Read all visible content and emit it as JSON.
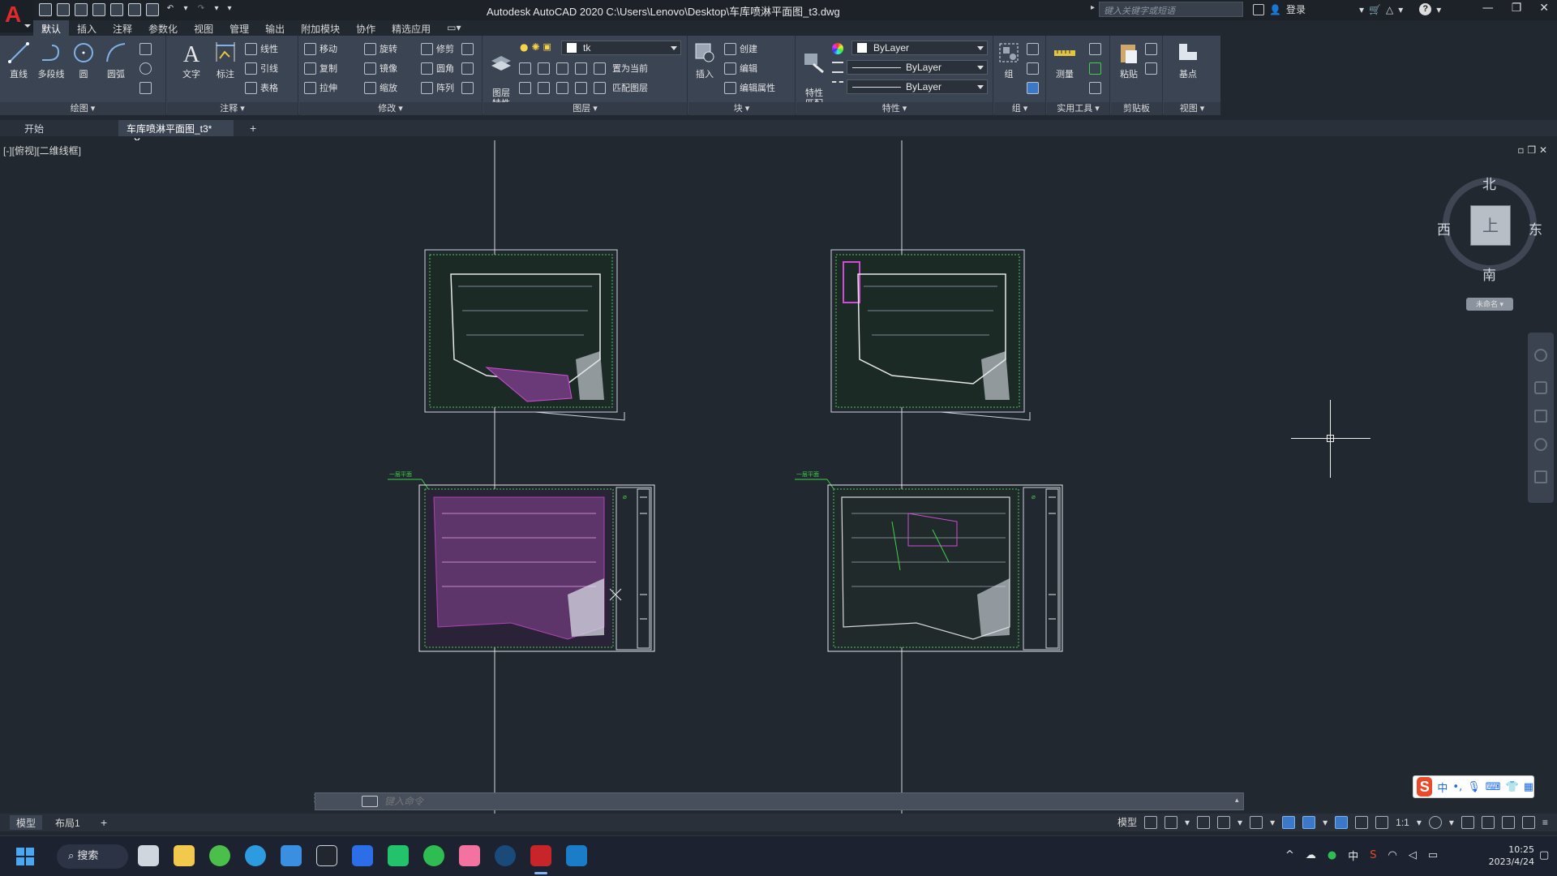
{
  "window": {
    "title": "Autodesk AutoCAD 2020    C:\\Users\\Lenovo\\Desktop\\车库喷淋平面图_t3.dwg",
    "search_placeholder": "键入关键字或短语",
    "login_label": "登录",
    "help_label": "?",
    "minimize": "—",
    "restore": "❐",
    "close": "✕"
  },
  "ribbon_tabs": [
    {
      "label": "默认"
    },
    {
      "label": "插入"
    },
    {
      "label": "注释"
    },
    {
      "label": "参数化"
    },
    {
      "label": "视图"
    },
    {
      "label": "管理"
    },
    {
      "label": "输出"
    },
    {
      "label": "附加模块"
    },
    {
      "label": "协作"
    },
    {
      "label": "精选应用"
    }
  ],
  "ribbon": {
    "draw": {
      "title": "绘图 ▾",
      "line": "直线",
      "polyline": "多段线",
      "circle": "圆",
      "arc": "圆弧"
    },
    "annotation": {
      "title": "注释 ▾",
      "text": "文字",
      "dimension": "标注",
      "linear": "线性",
      "leader": "引线",
      "table": "表格"
    },
    "modify": {
      "title": "修改 ▾",
      "move": "移动",
      "rotate": "旋转",
      "trim": "修剪",
      "copy": "复制",
      "mirror": "镜像",
      "fillet": "圆角",
      "stretch": "拉伸",
      "scale": "缩放",
      "array": "阵列"
    },
    "layers": {
      "title": "图层 ▾",
      "layer_properties": "图层\n特性",
      "current_layer": "tk",
      "set_current": "置为当前",
      "match_layer": "匹配图层"
    },
    "block": {
      "title": "块 ▾",
      "insert": "插入",
      "create": "创建",
      "edit": "编辑",
      "edit_attributes": "编辑属性"
    },
    "properties": {
      "title": "特性 ▾",
      "match": "特性\n匹配",
      "color": "ByLayer",
      "lineweight": "ByLayer",
      "linetype": "ByLayer"
    },
    "groups": {
      "title": "组 ▾",
      "group": "组"
    },
    "utilities": {
      "title": "实用工具 ▾",
      "measure": "测量"
    },
    "clipboard": {
      "title": "剪贴板",
      "paste": "粘贴"
    },
    "view": {
      "title": "视图 ▾",
      "base": "基点"
    }
  },
  "file_tabs": {
    "start": "开始",
    "document": "车库喷淋平面图_t3*",
    "close": "✕",
    "add": "+"
  },
  "viewport": {
    "label": "[-][俯视][二维线框]",
    "restore_glyph": "▫ ❐ ✕",
    "compass": {
      "north": "北",
      "south": "南",
      "east": "东",
      "west": "西",
      "top": "上"
    },
    "wcs": "未命名 ▾",
    "annotations": {
      "left_callout": "一层平面",
      "right_callout": "一层平面"
    }
  },
  "command_line": {
    "placeholder": "键入命令",
    "close_glyph": "✕",
    "customize_glyph": "🔧"
  },
  "model_tabs": [
    {
      "label": "模型"
    },
    {
      "label": "布局1"
    }
  ],
  "model_add": "+",
  "status": {
    "model": "模型",
    "scale": "1:1"
  },
  "ime": {
    "chinese": "中",
    "punct": "•,"
  },
  "taskbar": {
    "search": "搜索",
    "tray_lang": "中",
    "time": "10:25",
    "date": "2023/4/24"
  },
  "colors": {
    "accent": "#3c78c8",
    "viewport_bg": "#212830",
    "ribbon_bg": "#3b4453",
    "drawing_green": "#3fcf4a",
    "drawing_magenta": "#d24bd8",
    "autocad_red": "#e02b2b"
  }
}
